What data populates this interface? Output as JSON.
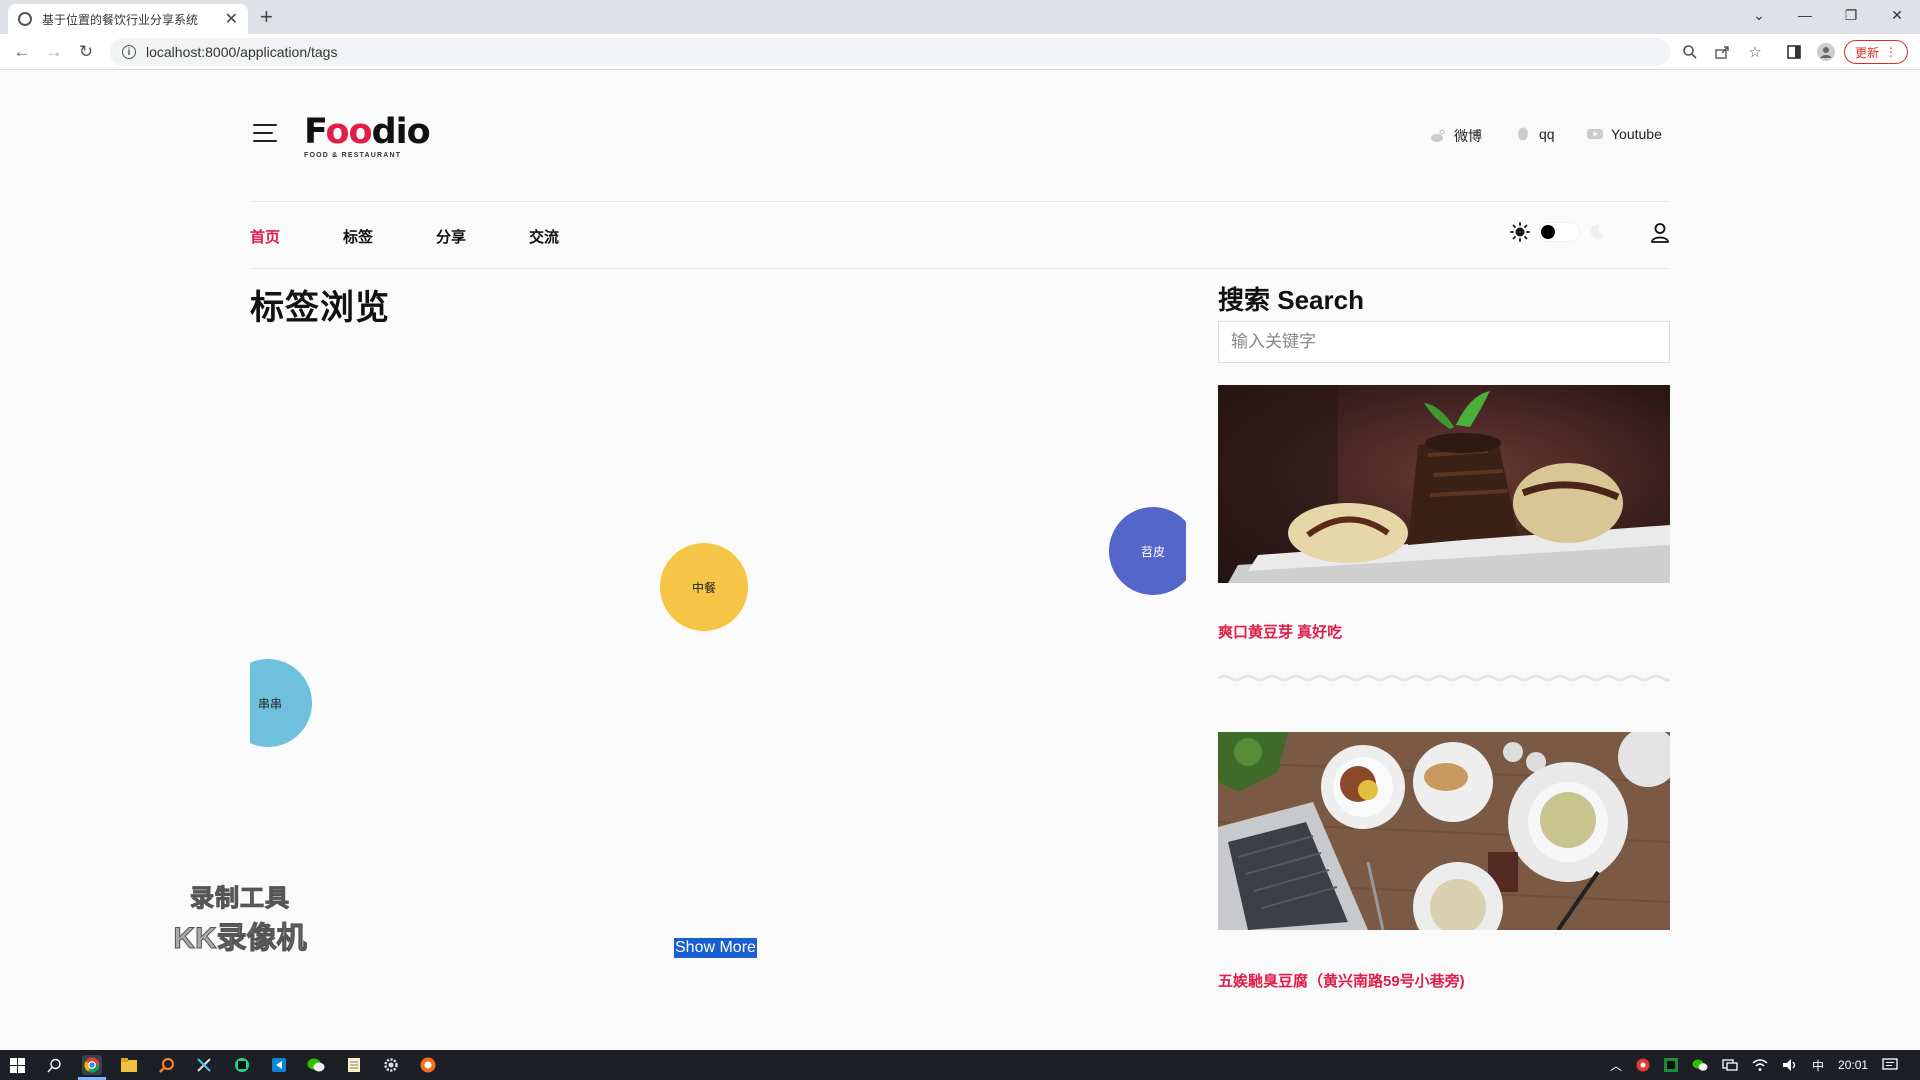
{
  "browser": {
    "tab_title": "基于位置的餐饮行业分享系统",
    "tab_close": "✕",
    "new_tab": "+",
    "url": "localhost:8000/application/tags",
    "update_label": "更新"
  },
  "header": {
    "logo_text_pre": "F",
    "logo_text_oo": "oo",
    "logo_text_post": "dio",
    "logo_sub": "FOOD & RESTAURANT",
    "social": [
      {
        "label": "微博",
        "icon": "weibo-icon"
      },
      {
        "label": "qq",
        "icon": "qq-icon"
      },
      {
        "label": "Youtube",
        "icon": "youtube-icon"
      }
    ]
  },
  "nav": {
    "items": [
      {
        "label": "首页",
        "active": true
      },
      {
        "label": "标签",
        "active": false
      },
      {
        "label": "分享",
        "active": false
      },
      {
        "label": "交流",
        "active": false
      }
    ]
  },
  "main": {
    "title": "标签浏览",
    "tags": [
      {
        "label": "中餐",
        "color": "#f6c545"
      },
      {
        "label": "苕皮",
        "color": "#5566c9"
      },
      {
        "label": "串串",
        "color": "#6ec0dc"
      },
      {
        "label": "",
        "color": "#4d5fc2"
      },
      {
        "label": "",
        "color": "#ee6262"
      }
    ],
    "show_more": "Show More"
  },
  "sidebar": {
    "search_title": "搜索 Search",
    "search_placeholder": "输入关键字",
    "posts": [
      {
        "title": "爽口黄豆芽 真好吃"
      },
      {
        "title": "五娭馳臭豆腐（黄兴南路59号小巷旁)"
      }
    ]
  },
  "watermark": {
    "line1": "录制工具",
    "line2": "KK录像机"
  },
  "taskbar": {
    "ime": "中",
    "time": "20:01"
  },
  "colors": {
    "accent": "#e11d48",
    "selection": "#1a5fd0"
  }
}
